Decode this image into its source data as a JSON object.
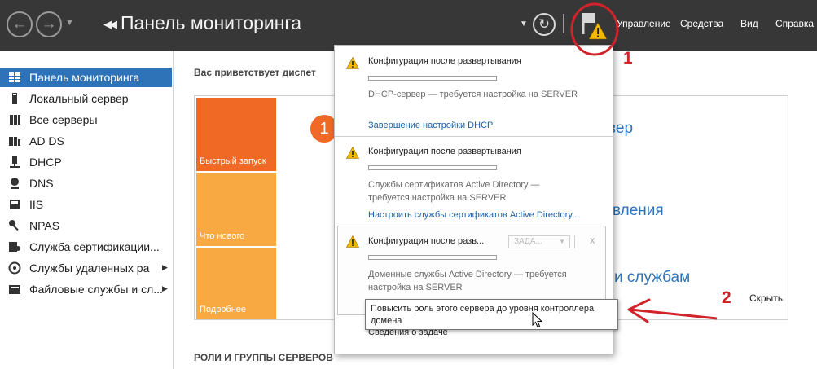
{
  "header": {
    "title": "Панель мониторинга",
    "menu": [
      "Управление",
      "Средства",
      "Вид",
      "Справка"
    ],
    "icons": [
      "back-icon",
      "forward-icon",
      "refresh-icon",
      "notification-flag-icon"
    ]
  },
  "sidebar": {
    "items": [
      {
        "label": "Панель мониторинга",
        "icon": "dashboard-icon",
        "selected": true
      },
      {
        "label": "Локальный сервер",
        "icon": "server-icon"
      },
      {
        "label": "Все серверы",
        "icon": "servers-icon"
      },
      {
        "label": "AD DS",
        "icon": "ad-ds-icon"
      },
      {
        "label": "DHCP",
        "icon": "dhcp-icon"
      },
      {
        "label": "DNS",
        "icon": "dns-icon"
      },
      {
        "label": "IIS",
        "icon": "iis-icon"
      },
      {
        "label": "NPAS",
        "icon": "npas-icon"
      },
      {
        "label": "Служба сертификации...",
        "icon": "certificate-icon"
      },
      {
        "label": "Службы удаленных ра",
        "icon": "remote-access-icon",
        "expandable": true
      },
      {
        "label": "Файловые службы и сл...",
        "icon": "file-services-icon",
        "expandable": true
      }
    ]
  },
  "main": {
    "welcome": "Вас приветствует диспет",
    "tiles": {
      "quick": "Быстрый запуск",
      "new": "Что нового",
      "more": "Подробнее"
    },
    "step_number": "1",
    "peek_texts": [
      "вер",
      "вления",
      "и службам"
    ],
    "hide": "Скрыть",
    "roles_heading": "РОЛИ И ГРУППЫ СЕРВЕРОВ"
  },
  "notifications": {
    "items": [
      {
        "title": "Конфигурация после развертывания",
        "description": "DHCP-сервер — требуется настройка на SERVER",
        "link": "Завершение настройки DHCP"
      },
      {
        "title": "Конфигурация после развертывания",
        "description_lines": [
          "Службы сертификатов Active Directory —",
          "требуется настройка на SERVER"
        ],
        "link": "Настроить службы сертификатов Active Directory..."
      },
      {
        "title": "Конфигурация после разв...",
        "task_combo": "ЗАДА...",
        "dismiss": "x",
        "description_lines": [
          "Доменные службы Active Directory — требуется",
          "настройка на SERVER"
        ],
        "link": "Повысить роль этого сервера до уровня контроллера домена"
      }
    ],
    "task_details": "Сведения о задаче"
  },
  "tooltip": {
    "lines": [
      "Повысить роль этого сервера до уровня контроллера",
      "домена"
    ]
  },
  "callouts": [
    "1",
    "2"
  ],
  "colors": {
    "topbar": "#373737",
    "selected": "#2e73b8",
    "tile_orange": "#f16a25",
    "tile_yellow": "#f9a942",
    "warning": "#f5b800",
    "callout": "#d0232a",
    "link": "#1a60a8"
  }
}
